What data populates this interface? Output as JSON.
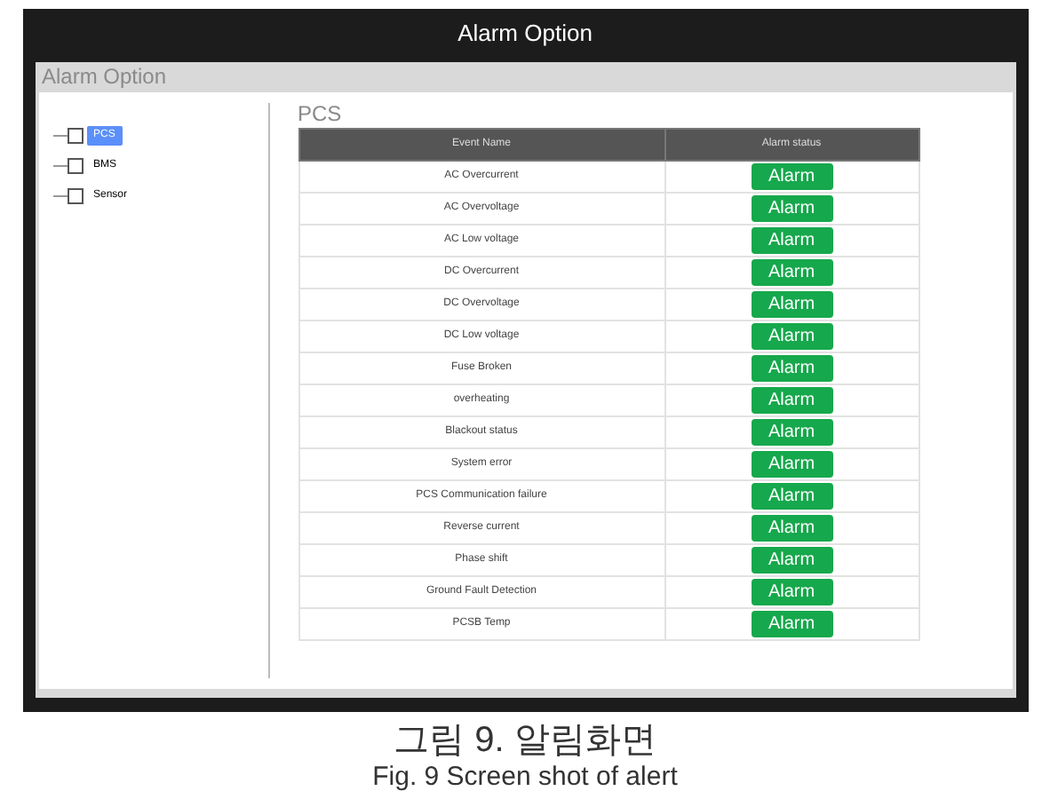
{
  "window": {
    "title": "Alarm Option"
  },
  "panel": {
    "title": "Alarm Option"
  },
  "tree": {
    "items": [
      {
        "label": "PCS",
        "selected": true,
        "checked": false
      },
      {
        "label": "BMS",
        "selected": false,
        "checked": false
      },
      {
        "label": "Sensor",
        "selected": false,
        "checked": false
      }
    ]
  },
  "section": {
    "title": "PCS"
  },
  "table": {
    "columns": [
      "Event Name",
      "Alarm status"
    ],
    "rows": [
      {
        "event": "AC Overcurrent",
        "status": "Alarm"
      },
      {
        "event": "AC Overvoltage",
        "status": "Alarm"
      },
      {
        "event": "AC Low voltage",
        "status": "Alarm"
      },
      {
        "event": "DC Overcurrent",
        "status": "Alarm"
      },
      {
        "event": "DC Overvoltage",
        "status": "Alarm"
      },
      {
        "event": "DC Low voltage",
        "status": "Alarm"
      },
      {
        "event": "Fuse Broken",
        "status": "Alarm"
      },
      {
        "event": "overheating",
        "status": "Alarm"
      },
      {
        "event": "Blackout status",
        "status": "Alarm"
      },
      {
        "event": "System error",
        "status": "Alarm"
      },
      {
        "event": "PCS Communication failure",
        "status": "Alarm"
      },
      {
        "event": "Reverse current",
        "status": "Alarm"
      },
      {
        "event": "Phase shift",
        "status": "Alarm"
      },
      {
        "event": "Ground Fault Detection",
        "status": "Alarm"
      },
      {
        "event": "PCSB Temp",
        "status": "Alarm"
      }
    ]
  },
  "caption": {
    "korean": "그림 9. 알림화면",
    "english": "Fig. 9 Screen shot of alert"
  }
}
